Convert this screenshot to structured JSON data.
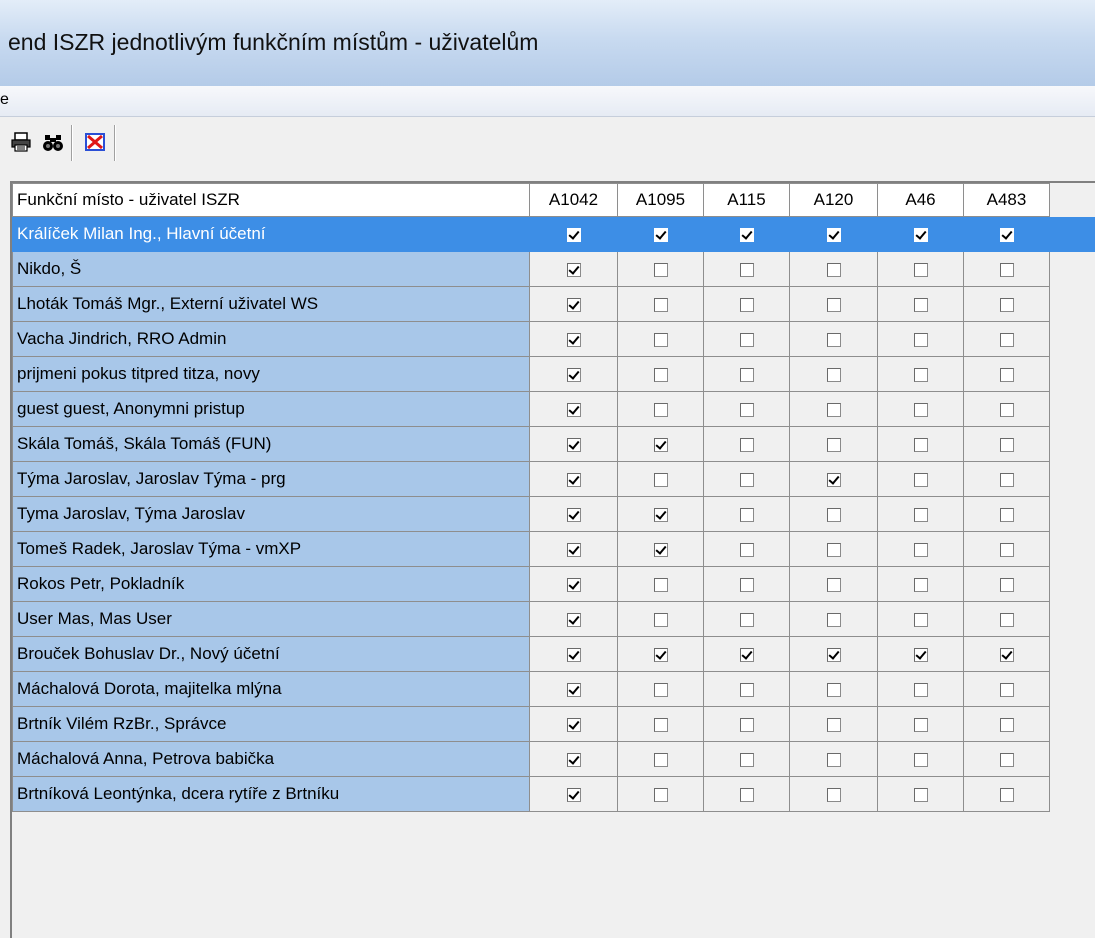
{
  "window": {
    "title": "end ISZR jednotlivým funkčním místům - uživatelům"
  },
  "menu": {
    "item": "e"
  },
  "toolbar": {
    "buttons": [
      {
        "icon": "print-icon"
      },
      {
        "icon": "binoculars-find-icon"
      },
      {
        "icon": "close-red-x-icon"
      }
    ]
  },
  "grid": {
    "name_header": "Funkční místo - uživatel ISZR",
    "columns": [
      "A1042",
      "A1095",
      "A115",
      "A120",
      "A46",
      "A483"
    ],
    "selected_row": 0,
    "rows": [
      {
        "name": "Králíček Milan  Ing., Hlavní účetní",
        "checks": [
          true,
          true,
          true,
          true,
          true,
          true
        ]
      },
      {
        "name": "Nikdo, Š",
        "checks": [
          true,
          false,
          false,
          false,
          false,
          false
        ]
      },
      {
        "name": "Lhoták Tomáš Mgr., Externí uživatel WS",
        "checks": [
          true,
          false,
          false,
          false,
          false,
          false
        ]
      },
      {
        "name": "Vacha Jindrich, RRO Admin",
        "checks": [
          true,
          false,
          false,
          false,
          false,
          false
        ]
      },
      {
        "name": "prijmeni pokus titpred titza, novy",
        "checks": [
          true,
          false,
          false,
          false,
          false,
          false
        ]
      },
      {
        "name": "guest guest, Anonymni pristup",
        "checks": [
          true,
          false,
          false,
          false,
          false,
          false
        ]
      },
      {
        "name": "Skála Tomáš, Skála Tomáš (FUN)",
        "checks": [
          true,
          true,
          false,
          false,
          false,
          false
        ]
      },
      {
        "name": "Týma Jaroslav, Jaroslav Týma - prg",
        "checks": [
          true,
          false,
          false,
          true,
          false,
          false
        ]
      },
      {
        "name": "Tyma Jaroslav, Týma Jaroslav",
        "checks": [
          true,
          true,
          false,
          false,
          false,
          false
        ]
      },
      {
        "name": "Tomeš Radek, Jaroslav Týma - vmXP",
        "checks": [
          true,
          true,
          false,
          false,
          false,
          false
        ]
      },
      {
        "name": "Rokos Petr, Pokladník",
        "checks": [
          true,
          false,
          false,
          false,
          false,
          false
        ]
      },
      {
        "name": "User Mas, Mas User",
        "checks": [
          true,
          false,
          false,
          false,
          false,
          false
        ]
      },
      {
        "name": "Brouček Bohuslav Dr., Nový účetní",
        "checks": [
          true,
          true,
          true,
          true,
          true,
          true
        ]
      },
      {
        "name": "Máchalová Dorota, majitelka mlýna",
        "checks": [
          true,
          false,
          false,
          false,
          false,
          false
        ]
      },
      {
        "name": "Brtník Vilém  RzBr., Správce",
        "checks": [
          true,
          false,
          false,
          false,
          false,
          false
        ]
      },
      {
        "name": "Máchalová Anna, Petrova babička",
        "checks": [
          true,
          false,
          false,
          false,
          false,
          false
        ]
      },
      {
        "name": "Brtníková Leontýnka, dcera rytíře z Brtníku",
        "checks": [
          true,
          false,
          false,
          false,
          false,
          false
        ]
      }
    ]
  }
}
